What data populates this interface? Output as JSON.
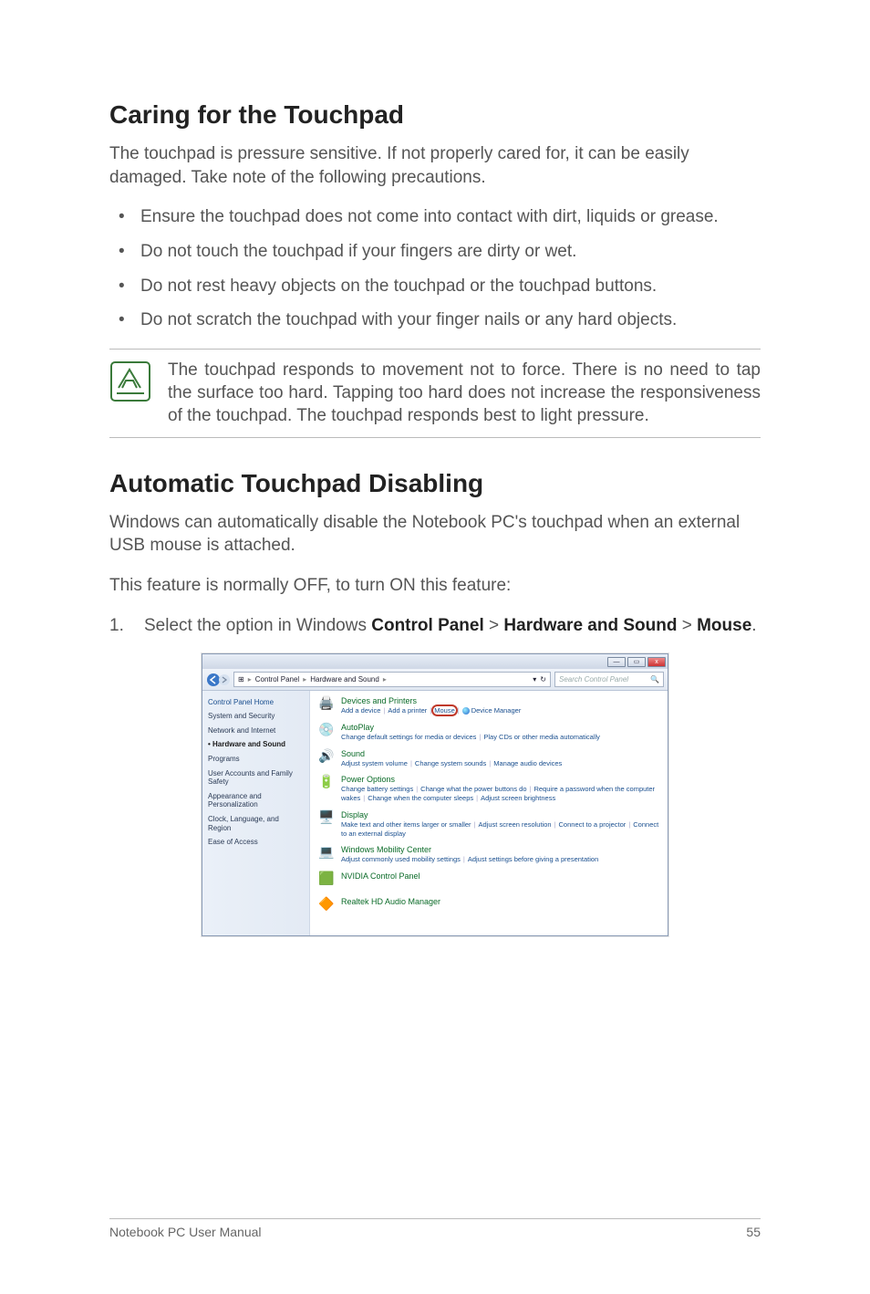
{
  "section1": {
    "heading": "Caring for the Touchpad",
    "intro": "The touchpad is pressure sensitive. If not properly cared for, it can be easily damaged. Take note of the following precautions.",
    "bullets": [
      "Ensure the touchpad does not come into contact with dirt, liquids or grease.",
      "Do not touch the touchpad if your fingers are dirty or wet.",
      "Do not rest heavy objects on the touchpad or the touchpad buttons.",
      "Do not scratch the touchpad with your finger nails or any hard objects."
    ],
    "note": "The touchpad responds to movement not to force. There is no need to tap the surface too hard. Tapping too hard does not increase the responsiveness of the touchpad. The touchpad responds best to light pressure."
  },
  "section2": {
    "heading": "Automatic Touchpad Disabling",
    "p1": "Windows can automatically disable the Notebook PC's touchpad when an external USB mouse is attached.",
    "p2": "This feature is normally OFF, to turn ON this feature:",
    "step_num": "1.",
    "step_pre": "Select the option in Windows ",
    "step_b1": "Control Panel",
    "step_gt1": " > ",
    "step_b2": "Hardware and Sound",
    "step_gt2": " > ",
    "step_b3": "Mouse",
    "step_post": "."
  },
  "cp": {
    "titlebar": {
      "min": "—",
      "max": "▭",
      "close": "x"
    },
    "nav": {
      "path_icon": "⊞",
      "path_parts": [
        "Control Panel",
        "Hardware and Sound"
      ],
      "sep": "▸",
      "dropdown": "▾",
      "refresh": "↻",
      "search_placeholder": "Search Control Panel",
      "search_icon": "🔍"
    },
    "sidebar": {
      "home": "Control Panel Home",
      "items": [
        "System and Security",
        "Network and Internet",
        "Hardware and Sound",
        "Programs",
        "User Accounts and Family Safety",
        "Appearance and Personalization",
        "Clock, Language, and Region",
        "Ease of Access"
      ],
      "active_index": 2
    },
    "categories": [
      {
        "icon": "🖨️",
        "title": "Devices and Printers",
        "links": [
          "Add a device",
          "Add a printer",
          "Mouse",
          "Device Manager"
        ],
        "mouse_index": 2,
        "dm_index": 3
      },
      {
        "icon": "💿",
        "title": "AutoPlay",
        "links": [
          "Change default settings for media or devices",
          "Play CDs or other media automatically"
        ]
      },
      {
        "icon": "🔊",
        "title": "Sound",
        "links": [
          "Adjust system volume",
          "Change system sounds",
          "Manage audio devices"
        ]
      },
      {
        "icon": "🔋",
        "title": "Power Options",
        "links": [
          "Change battery settings",
          "Change what the power buttons do",
          "Require a password when the computer wakes",
          "Change when the computer sleeps",
          "Adjust screen brightness"
        ]
      },
      {
        "icon": "🖥️",
        "title": "Display",
        "links": [
          "Make text and other items larger or smaller",
          "Adjust screen resolution",
          "Connect to a projector",
          "Connect to an external display"
        ]
      },
      {
        "icon": "💻",
        "title": "Windows Mobility Center",
        "links": [
          "Adjust commonly used mobility settings",
          "Adjust settings before giving a presentation"
        ]
      },
      {
        "icon": "🟩",
        "title": "NVIDIA Control Panel",
        "links": []
      },
      {
        "icon": "🔶",
        "title": "Realtek HD Audio Manager",
        "links": []
      }
    ]
  },
  "footer": {
    "left": "Notebook PC User Manual",
    "right": "55"
  }
}
